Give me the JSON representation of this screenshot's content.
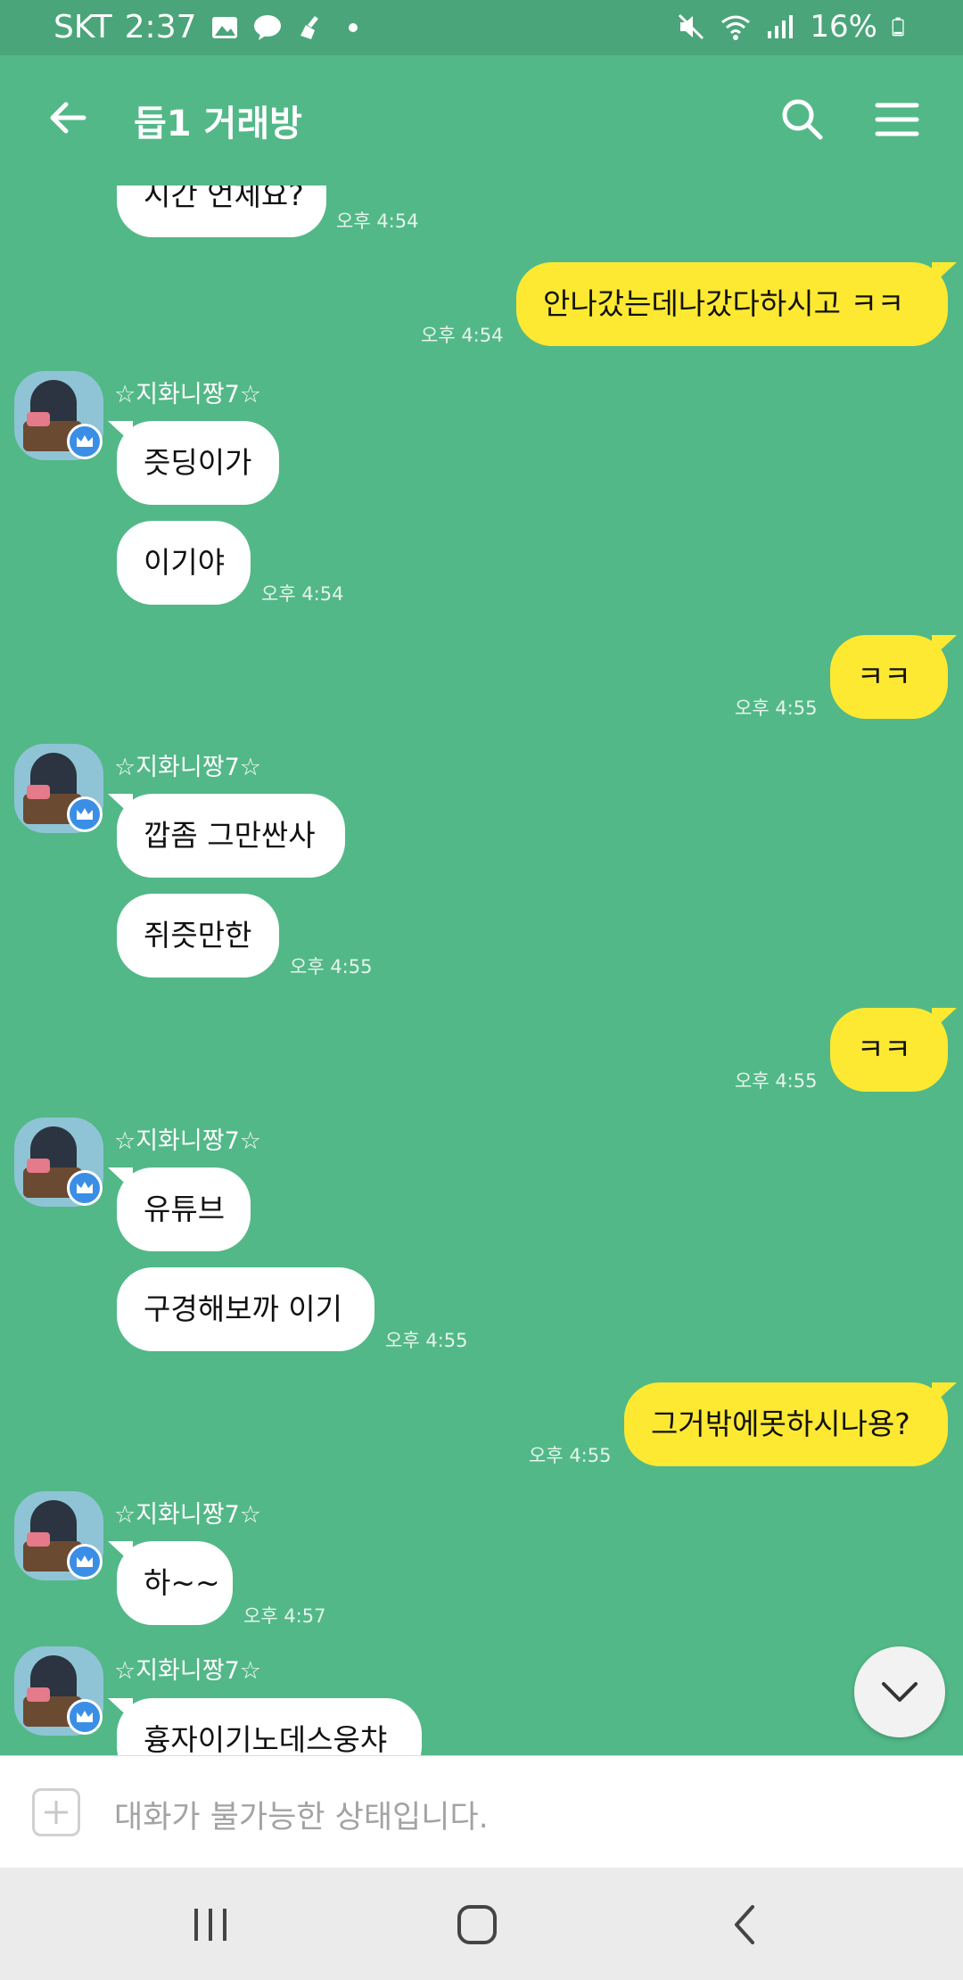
{
  "status_bar": {
    "carrier": "SKT",
    "time": "2:37",
    "battery": "16%"
  },
  "header": {
    "title": "듭1 거래방"
  },
  "messages": [
    {
      "type": "them",
      "text": "시간 언제요?",
      "time": "오후 4:54"
    },
    {
      "type": "me",
      "text": "안나갔는데나갔다하시고 ㅋㅋ",
      "time": "오후 4:54"
    },
    {
      "type": "them",
      "sender": "☆지화니짱7☆",
      "texts": [
        "즛딩이가",
        "이기야"
      ],
      "time": "오후 4:54"
    },
    {
      "type": "me",
      "text": "ㅋㅋ",
      "time": "오후 4:55"
    },
    {
      "type": "them",
      "sender": "☆지화니짱7☆",
      "texts": [
        "깝좀 그만싼사",
        "쥐즛만한"
      ],
      "time": "오후 4:55"
    },
    {
      "type": "me",
      "text": "ㅋㅋ",
      "time": "오후 4:55"
    },
    {
      "type": "them",
      "sender": "☆지화니짱7☆",
      "texts": [
        "유튜브",
        "구경해보까 이기"
      ],
      "time": "오후 4:55"
    },
    {
      "type": "me",
      "text": "그거밖에못하시나용?",
      "time": "오후 4:55"
    },
    {
      "type": "them",
      "sender": "☆지화니짱7☆",
      "texts": [
        "하~~"
      ],
      "time": "오후 4:57"
    },
    {
      "type": "them",
      "sender": "☆지화니짱7☆",
      "texts": [
        "흉자이기노데스웅챠"
      ]
    }
  ],
  "input": {
    "placeholder": "대화가 불가능한 상태입니다."
  },
  "colors": {
    "background": "#52b887",
    "status_bar": "#4aa57a",
    "my_bubble": "#fde932",
    "their_bubble": "#ffffff"
  }
}
